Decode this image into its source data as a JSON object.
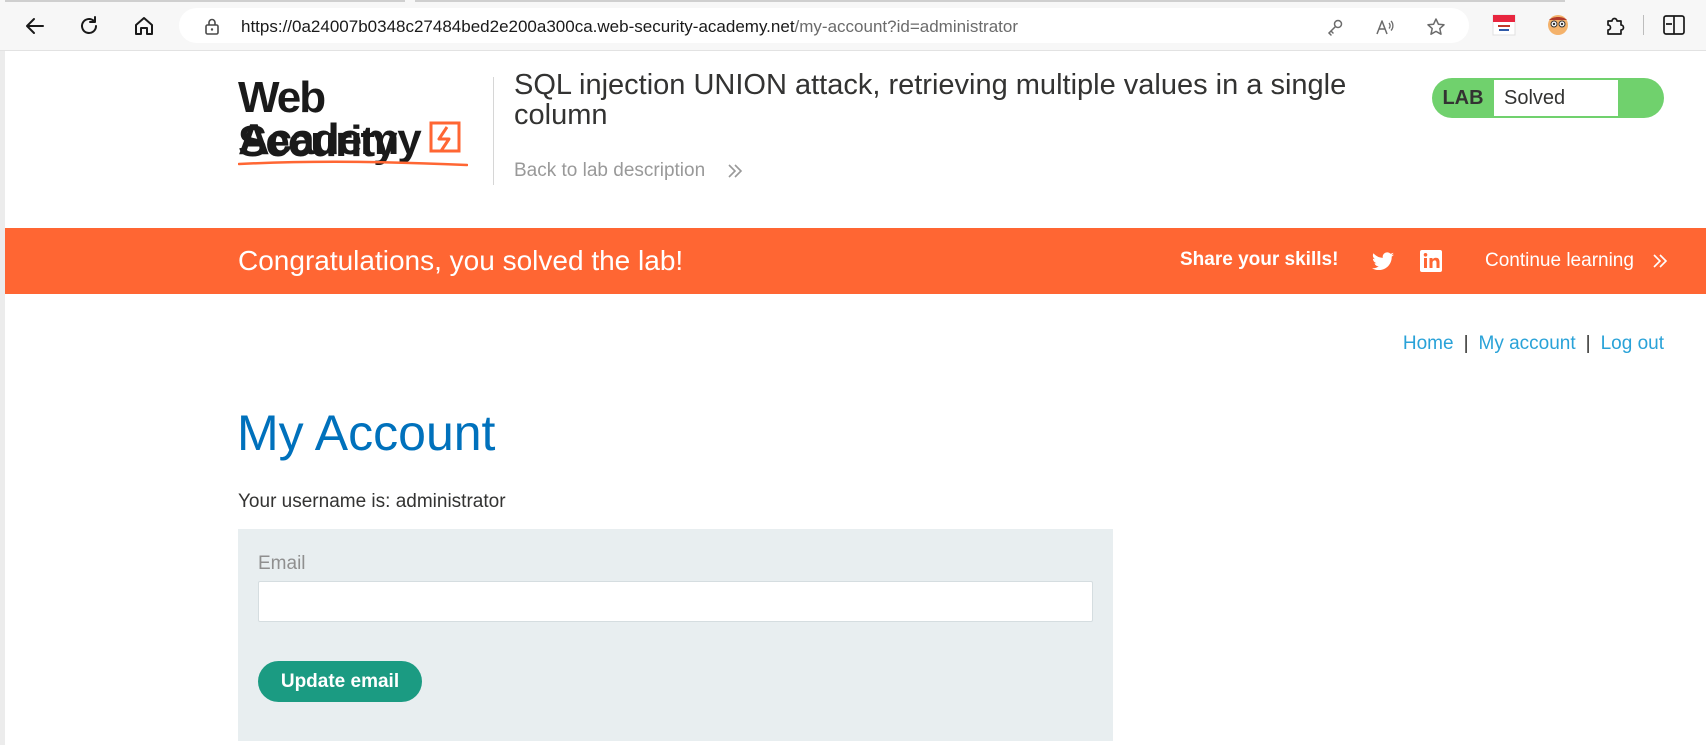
{
  "browser": {
    "url_host": "https://0a24007b0348c27484bed2e200a300ca.web-security-academy.net",
    "url_path": "/my-account?id=administrator",
    "icons": [
      "back-icon",
      "reload-icon",
      "home-icon",
      "lock-icon",
      "key-icon",
      "read-aloud-icon",
      "favorite-star-icon",
      "extension-icon",
      "profile-icon",
      "puzzle-icon",
      "split-screen-icon"
    ]
  },
  "header": {
    "logo_line1": "Web Security",
    "logo_line2": "Academy",
    "lab_title": "SQL injection UNION attack, retrieving multiple values in a single column",
    "back_link": "Back to lab description",
    "lab_badge": "LAB",
    "lab_status": "Solved",
    "status_color": "#70d16d"
  },
  "banner": {
    "message": "Congratulations, you solved the lab!",
    "share_label": "Share your skills!",
    "continue_label": "Continue learning",
    "color": "#ff6633"
  },
  "nav": {
    "home": "Home",
    "separator1": "|",
    "my_account": "My account",
    "separator2": "|",
    "log_out": "Log out"
  },
  "main": {
    "title": "My Account",
    "username_text": "Your username is: administrator",
    "email_label": "Email",
    "email_value": "",
    "update_button": "Update email"
  }
}
